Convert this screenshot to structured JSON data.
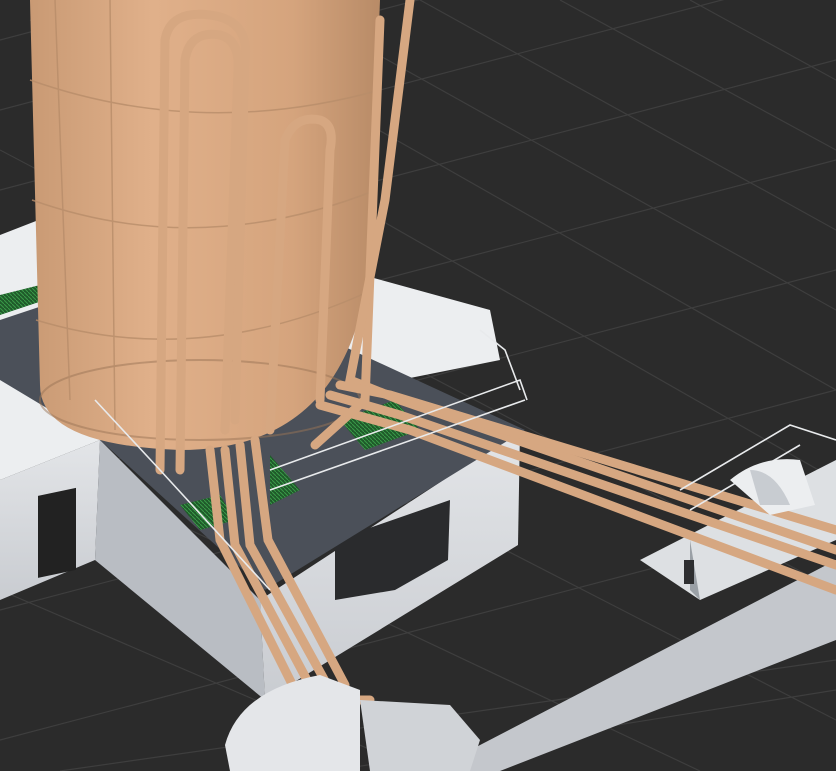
{
  "viewport": {
    "background_color": "#2b2b2b",
    "grid_color": "#3d3d3d",
    "grid_visible": true
  },
  "scene": {
    "objects": [
      {
        "name": "storage-tank",
        "color": "#d8a882"
      },
      {
        "name": "pipe-bundle",
        "color": "#d4a57e"
      },
      {
        "name": "concrete-platform",
        "color": "#d6d8dc"
      },
      {
        "name": "deck-floor",
        "color": "#4b5059"
      },
      {
        "name": "safety-railing",
        "color": "#e6e8ea"
      },
      {
        "name": "grating-panels",
        "color": "#2f7d3a"
      },
      {
        "name": "pipe-supports",
        "color": "#e2e4e7"
      }
    ]
  }
}
